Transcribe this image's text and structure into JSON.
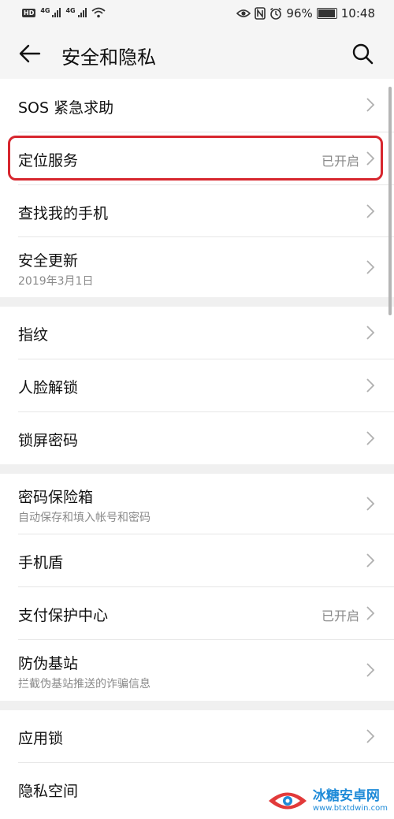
{
  "status_bar": {
    "hd": "HD",
    "net1": "4G",
    "net2": "4G",
    "battery": "96%",
    "time": "10:48"
  },
  "header": {
    "title": "安全和隐私",
    "back_icon": "arrow-left-icon",
    "search_icon": "search-icon"
  },
  "groups": [
    {
      "items": [
        {
          "label": "SOS 紧急求助"
        },
        {
          "label": "定位服务",
          "value": "已开启",
          "highlighted": true
        },
        {
          "label": "查找我的手机"
        },
        {
          "label": "安全更新",
          "sub": "2019年3月1日"
        }
      ]
    },
    {
      "items": [
        {
          "label": "指纹"
        },
        {
          "label": "人脸解锁"
        },
        {
          "label": "锁屏密码"
        }
      ]
    },
    {
      "items": [
        {
          "label": "密码保险箱",
          "sub": "自动保存和填入帐号和密码"
        },
        {
          "label": "手机盾"
        },
        {
          "label": "支付保护中心",
          "value": "已开启"
        },
        {
          "label": "防伪基站",
          "sub": "拦截伪基站推送的诈骗信息"
        }
      ]
    },
    {
      "items": [
        {
          "label": "应用锁"
        },
        {
          "label": "隐私空间"
        }
      ]
    }
  ],
  "watermark": {
    "title": "冰糖安卓网",
    "url": "www.btxtdwin.com"
  },
  "colors": {
    "highlight": "#d7262e",
    "background": "#f0f0f0",
    "card": "#ffffff",
    "secondary_text": "#8a8a8a"
  }
}
